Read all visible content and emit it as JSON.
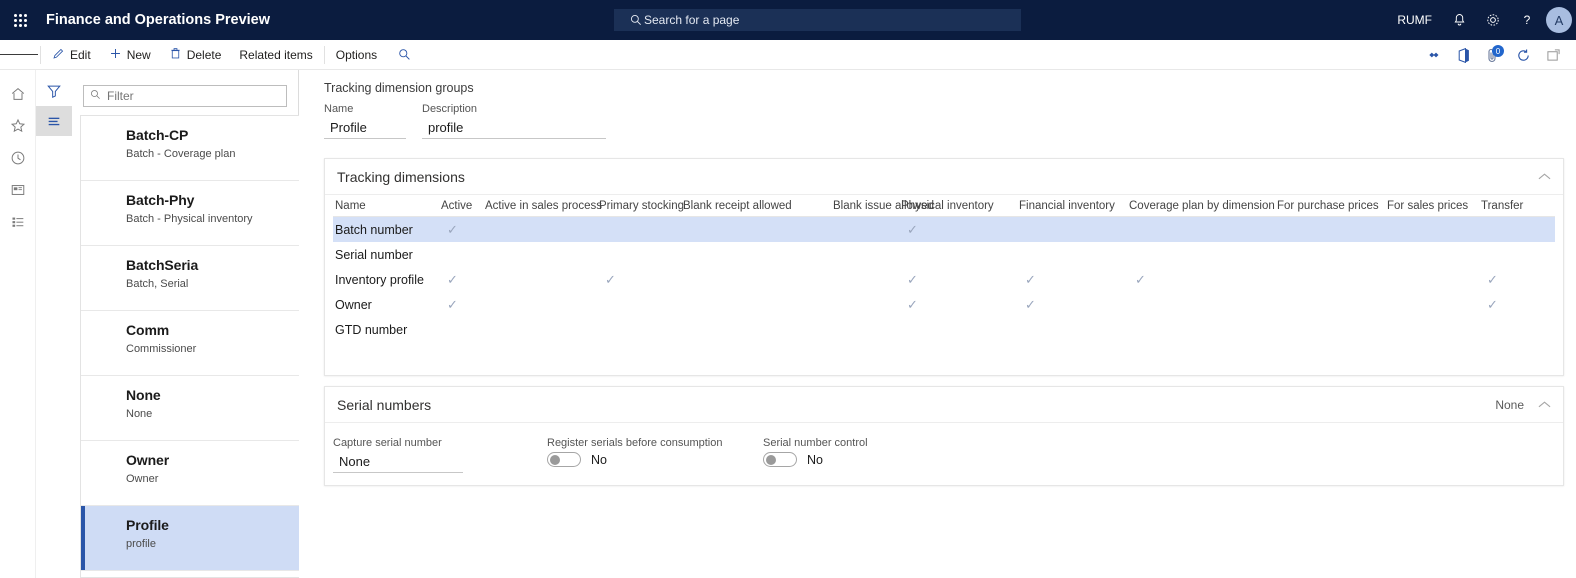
{
  "header": {
    "waffle_icon": "app-launcher-icon",
    "app_title": "Finance and Operations Preview",
    "search_placeholder": "Search for a page",
    "search_icon": "search-icon",
    "company": "RUMF",
    "notification_icon": "bell-icon",
    "settings_icon": "gear-icon",
    "help_icon": "question-mark-icon",
    "avatar_initial": "A"
  },
  "commandbar": {
    "menu_icon": "hamburger-icon",
    "items": [
      {
        "label": "Edit",
        "icon": "pencil-icon"
      },
      {
        "label": "New",
        "icon": "plus-icon"
      },
      {
        "label": "Delete",
        "icon": "trash-icon"
      },
      {
        "label": "Related items",
        "icon": ""
      },
      {
        "label": "Options",
        "icon": ""
      }
    ],
    "search_icon": "search-icon",
    "right_icons": [
      {
        "name": "share-icon",
        "badge": ""
      },
      {
        "name": "office-app-icon",
        "badge": ""
      },
      {
        "name": "attachment-icon",
        "badge": "0"
      },
      {
        "name": "refresh-icon",
        "badge": ""
      },
      {
        "name": "open-in-new-window-icon",
        "badge": ""
      }
    ]
  },
  "rail": {
    "icons": [
      "home-icon",
      "favorites-star-icon",
      "recent-clock-icon",
      "workspaces-icon",
      "modules-list-icon"
    ]
  },
  "listpane": {
    "tabs": [
      {
        "name": "filter-tab",
        "icon": "funnel-icon",
        "active": false
      },
      {
        "name": "list-tab",
        "icon": "list-lines-icon",
        "active": true
      }
    ],
    "filter_placeholder": "Filter",
    "filter_icon": "search-icon",
    "items": [
      {
        "title": "Batch-CP",
        "subtitle": "Batch - Coverage plan",
        "selected": false
      },
      {
        "title": "Batch-Phy",
        "subtitle": "Batch - Physical inventory",
        "selected": false
      },
      {
        "title": "BatchSeria",
        "subtitle": "Batch, Serial",
        "selected": false
      },
      {
        "title": "Comm",
        "subtitle": "Commissioner",
        "selected": false
      },
      {
        "title": "None",
        "subtitle": "None",
        "selected": false
      },
      {
        "title": "Owner",
        "subtitle": "Owner",
        "selected": false
      },
      {
        "title": "Profile",
        "subtitle": "profile",
        "selected": true
      }
    ]
  },
  "main": {
    "page_title": "Tracking dimension groups",
    "fields": {
      "name_label": "Name",
      "name_value": "Profile",
      "description_label": "Description",
      "description_value": "profile"
    },
    "tracking_section": {
      "title": "Tracking dimensions",
      "collapse_icon": "chevron-up-icon",
      "columns": [
        "Name",
        "Active",
        "Active in sales process",
        "Primary stocking",
        "Blank receipt allowed",
        "Blank issue allowed",
        "Physical inventory",
        "Financial inventory",
        "Coverage plan by dimension",
        "For purchase prices",
        "For sales prices",
        "Transfer"
      ],
      "rows": [
        {
          "name": "Batch number",
          "selected": true,
          "checks": [
            true,
            false,
            false,
            false,
            false,
            true,
            false,
            false,
            false,
            false,
            false
          ]
        },
        {
          "name": "Serial number",
          "selected": false,
          "checks": [
            false,
            false,
            false,
            false,
            false,
            false,
            false,
            false,
            false,
            false,
            false
          ]
        },
        {
          "name": "Inventory profile",
          "selected": false,
          "checks": [
            true,
            false,
            true,
            false,
            false,
            true,
            true,
            true,
            false,
            false,
            true
          ]
        },
        {
          "name": "Owner",
          "selected": false,
          "checks": [
            true,
            false,
            false,
            false,
            false,
            true,
            true,
            false,
            false,
            false,
            true
          ]
        },
        {
          "name": "GTD number",
          "selected": false,
          "checks": [
            false,
            false,
            false,
            false,
            false,
            false,
            false,
            false,
            false,
            false,
            false
          ]
        }
      ],
      "check_glyph": "✓"
    },
    "serial_section": {
      "title": "Serial numbers",
      "summary": "None",
      "collapse_icon": "chevron-up-icon",
      "capture_label": "Capture serial number",
      "capture_value": "None",
      "register_label": "Register serials before consumption",
      "register_value": "No",
      "control_label": "Serial number control",
      "control_value": "No"
    }
  },
  "colors": {
    "header_navy": "#0b1c3f",
    "accent_blue": "#2a55a8",
    "selected_row": "#d4e0f7",
    "selected_list": "#cfdcf5"
  }
}
